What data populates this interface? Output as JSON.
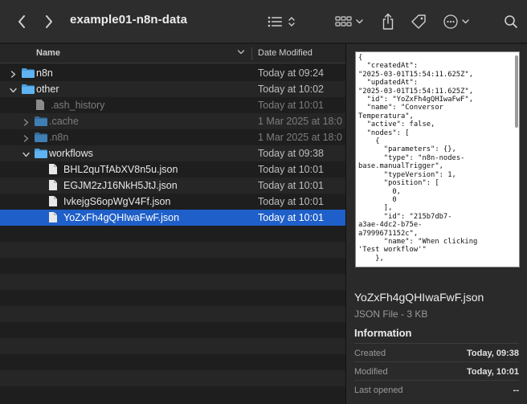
{
  "window": {
    "title": "example01-n8n-data"
  },
  "toolbar": {
    "back_icon": "chevron-left-icon",
    "forward_icon": "chevron-right-icon",
    "view_icon": "list-view-icon",
    "group_icon": "group-grid-icon",
    "share_icon": "share-icon",
    "tag_icon": "tag-icon",
    "more_icon": "ellipsis-circle-icon"
  },
  "list": {
    "columns": {
      "name": "Name",
      "date": "Date Modified"
    },
    "rows": [
      {
        "name": "n8n",
        "date": "Today at 09:24",
        "kind": "folder",
        "depth": 0,
        "disclosure": "collapsed",
        "dim": false,
        "selected": false
      },
      {
        "name": "other",
        "date": "Today at 10:02",
        "kind": "folder",
        "depth": 0,
        "disclosure": "expanded",
        "dim": false,
        "selected": false
      },
      {
        "name": ".ash_history",
        "date": "Today at 10:01",
        "kind": "file",
        "depth": 1,
        "disclosure": "none",
        "dim": true,
        "selected": false
      },
      {
        "name": ".cache",
        "date": "1 Mar 2025 at 18:0",
        "kind": "folder",
        "depth": 1,
        "disclosure": "collapsed",
        "dim": true,
        "selected": false
      },
      {
        "name": ".n8n",
        "date": "1 Mar 2025 at 18:0",
        "kind": "folder",
        "depth": 1,
        "disclosure": "collapsed",
        "dim": true,
        "selected": false
      },
      {
        "name": "workflows",
        "date": "Today at 09:38",
        "kind": "folder",
        "depth": 1,
        "disclosure": "expanded",
        "dim": false,
        "selected": false
      },
      {
        "name": "BHL2quTfAbXV8n5u.json",
        "date": "Today at 10:01",
        "kind": "file",
        "depth": 2,
        "disclosure": "none",
        "dim": false,
        "selected": false
      },
      {
        "name": "EGJM2zJ16NkH5JtJ.json",
        "date": "Today at 10:01",
        "kind": "file",
        "depth": 2,
        "disclosure": "none",
        "dim": false,
        "selected": false
      },
      {
        "name": "IvkejgS6opWgV4Ff.json",
        "date": "Today at 10:01",
        "kind": "file",
        "depth": 2,
        "disclosure": "none",
        "dim": false,
        "selected": false
      },
      {
        "name": "YoZxFh4gQHIwaFwF.json",
        "date": "Today at 10:01",
        "kind": "file",
        "depth": 2,
        "disclosure": "none",
        "dim": false,
        "selected": true
      }
    ],
    "empty_rows": 11
  },
  "preview": {
    "code": "{\n  \"createdAt\":\n\"2025-03-01T15:54:11.625Z\",\n  \"updatedAt\":\n\"2025-03-01T15:54:11.625Z\",\n  \"id\": \"YoZxFh4gQHIwaFwF\",\n  \"name\": \"Conversor\nTemperatura\",\n  \"active\": false,\n  \"nodes\": [\n    {\n      \"parameters\": {},\n      \"type\": \"n8n-nodes-\nbase.manualTrigger\",\n      \"typeVersion\": 1,\n      \"position\": [\n        0,\n        0\n      ],\n      \"id\": \"215b7db7-\na3ae-4dc2-b75e-\na7999671152c\",\n      \"name\": \"When clicking\n'Test workflow'\"\n    },",
    "file_name": "YoZxFh4gQHIwaFwF.json",
    "file_kind": "JSON File - 3 KB",
    "info_heading": "Information",
    "info": [
      {
        "label": "Created",
        "value": "Today, 09:38"
      },
      {
        "label": "Modified",
        "value": "Today, 10:01"
      },
      {
        "label": "Last opened",
        "value": "--"
      }
    ]
  }
}
